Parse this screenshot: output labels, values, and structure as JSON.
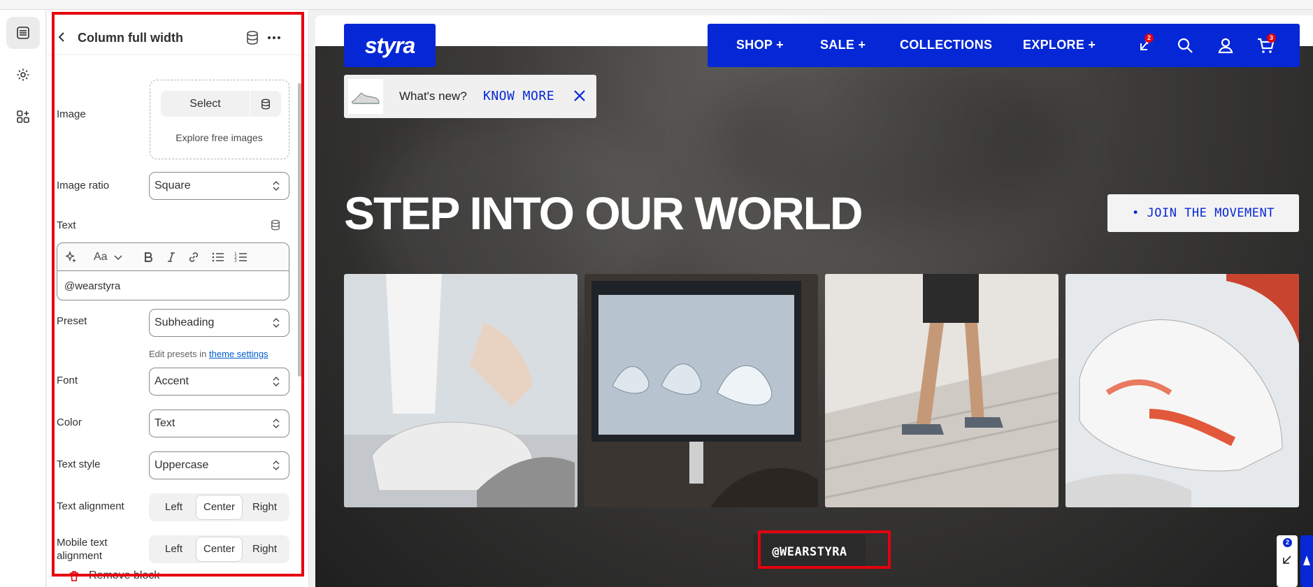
{
  "rail": {
    "items": [
      {
        "name": "sections-icon"
      },
      {
        "name": "settings-icon"
      },
      {
        "name": "apps-icon"
      }
    ]
  },
  "panel": {
    "title": "Column full width",
    "fields": {
      "image_label": "Image",
      "select_label": "Select",
      "explore_label": "Explore free images",
      "image_ratio_label": "Image ratio",
      "image_ratio_value": "Square",
      "text_label": "Text",
      "text_value": "@wearstyra",
      "rte_font_label": "Aa",
      "preset_label": "Preset",
      "preset_value": "Subheading",
      "hint_prefix": "Edit presets in",
      "hint_link": "theme settings",
      "font_label": "Font",
      "font_value": "Accent",
      "color_label": "Color",
      "color_value": "Text",
      "text_style_label": "Text style",
      "text_style_value": "Uppercase",
      "text_alignment_label": "Text alignment",
      "mobile_text_alignment_label": "Mobile text alignment",
      "alignment_options": [
        "Left",
        "Center",
        "Right"
      ],
      "alignment_selected": "Center",
      "mobile_alignment_selected": "Center"
    },
    "remove_label": "Remove block"
  },
  "preview": {
    "logo_text": "styra",
    "nav": {
      "items": [
        "SHOP +",
        "SALE +",
        "COLLECTIONS",
        "EXPLORE +"
      ],
      "compare_count": "2",
      "cart_count": "3"
    },
    "popup": {
      "text": "What's new?",
      "link": "KNOW MORE"
    },
    "headline": "STEP INTO OUR WORLD",
    "cta": "• JOIN THE MOVEMENT",
    "handle": "@WEARSTYRA",
    "side_badge": "2"
  },
  "colors": {
    "brand_blue": "#0627d6",
    "highlight_red": "#e5000f",
    "link_blue": "#005bd3"
  }
}
